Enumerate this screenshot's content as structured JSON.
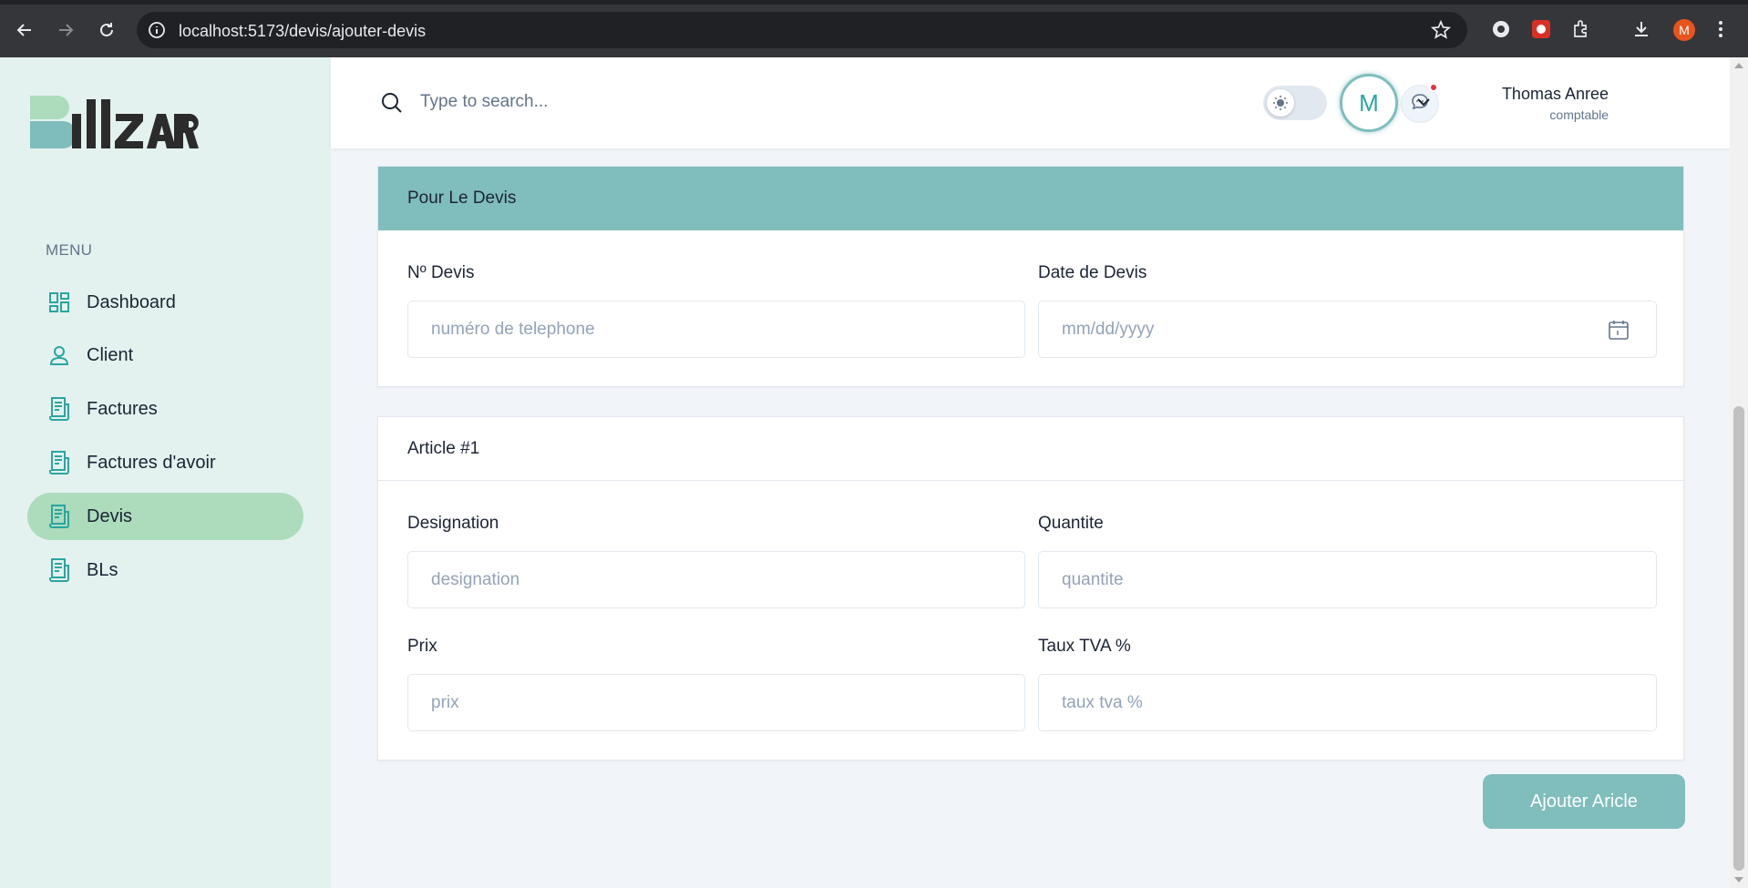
{
  "browser": {
    "url": "localhost:5173/devis/ajouter-devis",
    "profile_initial": "M"
  },
  "sidebar": {
    "logo_text": "Billzar",
    "menu_title": "MENU",
    "items": [
      {
        "label": "Dashboard",
        "icon": "dashboard-icon"
      },
      {
        "label": "Client",
        "icon": "user-icon"
      },
      {
        "label": "Factures",
        "icon": "receipt-icon"
      },
      {
        "label": "Factures d'avoir",
        "icon": "receipt-icon"
      },
      {
        "label": "Devis",
        "icon": "receipt-icon",
        "active": true
      },
      {
        "label": "BLs",
        "icon": "receipt-icon"
      }
    ]
  },
  "header": {
    "search_placeholder": "Type to search...",
    "user_name": "Thomas Anree",
    "user_role": "comptable",
    "avatar_initial": "M"
  },
  "devis_card": {
    "title": "Pour Le Devis",
    "numero_label": "Nº Devis",
    "numero_placeholder": "numéro de telephone",
    "date_label": "Date de Devis",
    "date_placeholder": "mm/dd/yyyy"
  },
  "article_card": {
    "title": "Article #1",
    "designation_label": "Designation",
    "designation_placeholder": "designation",
    "quantite_label": "Quantite",
    "quantite_placeholder": "quantite",
    "prix_label": "Prix",
    "prix_placeholder": "prix",
    "tva_label": "Taux TVA %",
    "tva_placeholder": "taux tva %"
  },
  "actions": {
    "add_article_label": "Ajouter Aricle"
  },
  "colors": {
    "accent": "#80bdbd",
    "sidebar_bg": "#e4f2ef",
    "active_item": "#acdcbc",
    "icon_teal": "#2aa5a0"
  }
}
